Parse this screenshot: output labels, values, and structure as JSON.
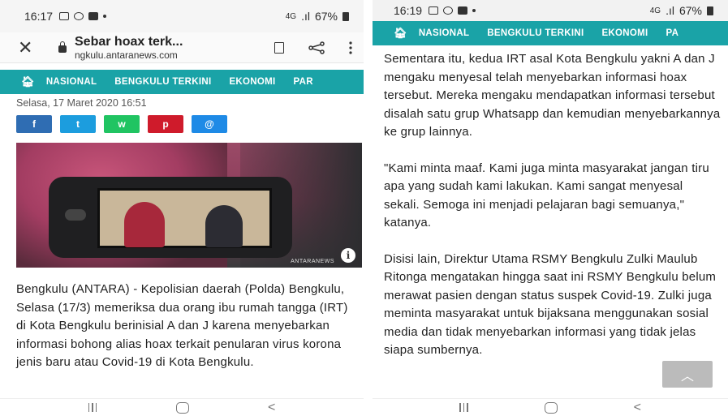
{
  "left": {
    "status": {
      "time": "16:17",
      "signal": "4G",
      "battery": "67%"
    },
    "urlbar": {
      "title": "Sebar hoax terk...",
      "domain": "ngkulu.antaranews.com"
    },
    "nav": [
      "NASIONAL",
      "BENGKULU TERKINI",
      "EKONOMI",
      "PAR"
    ],
    "date": "Selasa, 17 Maret 2020 16:51",
    "social": [
      "f",
      "t",
      "w",
      "p",
      "@"
    ],
    "photo": {
      "watermark": "ANTARANEWS",
      "info_icon": "i"
    },
    "article": "Bengkulu (ANTARA) - Kepolisian daerah (Polda) Bengkulu, Selasa (17/3) memeriksa dua orang ibu rumah tangga (IRT) di Kota Bengkulu berinisial A dan J karena menyebarkan informasi bohong alias hoax terkait penularan virus korona jenis baru atau Covid-19 di Kota Bengkulu."
  },
  "right": {
    "status": {
      "time": "16:19",
      "signal": "4G",
      "battery": "67%"
    },
    "nav": [
      "NASIONAL",
      "BENGKULU TERKINI",
      "EKONOMI",
      "PA"
    ],
    "paragraphs": [
      "Sementara itu, kedua IRT asal Kota Bengkulu yakni A dan J mengaku menyesal telah menyebarkan informasi hoax tersebut. Mereka mengaku mendapatkan informasi tersebut disalah satu grup Whatsapp dan kemudian menyebarkannya ke grup lainnya.",
      "\"Kami minta maaf. Kami juga minta masyarakat jangan tiru apa yang sudah kami lakukan. Kami sangat menyesal sekali. Semoga ini menjadi pelajaran bagi semuanya,\" katanya.",
      "Disisi lain, Direktur Utama RSMY Bengkulu Zulki Maulub Ritonga mengatakan hingga saat ini RSMY Bengkulu belum merawat pasien dengan status suspek Covid-19. Zulki juga meminta masyarakat untuk bijaksana menggunakan sosial media dan tidak menyebarkan informasi yang tidak jelas siapa sumbernya."
    ],
    "scroll_top_icon": "chevron-up"
  },
  "colors": {
    "nav_bg": "#1aa3a7",
    "facebook": "#2f6db3",
    "twitter": "#1c9dde",
    "whatsapp": "#20c462",
    "pinterest": "#cf1b2b",
    "email": "#1e8ae6"
  }
}
